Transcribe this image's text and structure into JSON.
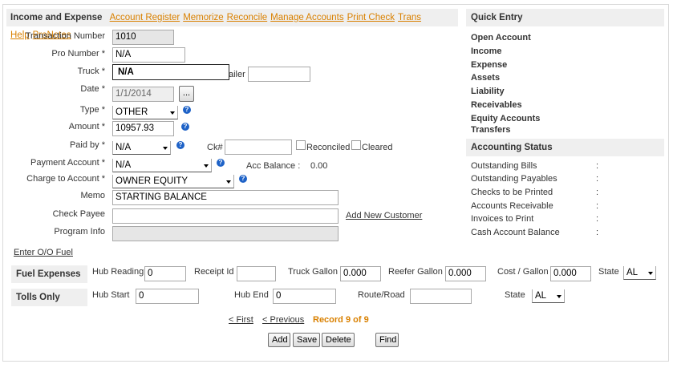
{
  "header": {
    "title": "Income and Expense",
    "links": [
      "Account Register",
      "Memorize",
      "Reconcile",
      "Manage Accounts",
      "Print Check",
      "Trans Help",
      "ProNotes"
    ]
  },
  "form": {
    "transaction_number": {
      "label": "Transaction Number",
      "value": "1010"
    },
    "pro_number": {
      "label": "Pro Number *",
      "value": "N/A"
    },
    "truck": {
      "label": "Truck *",
      "value": "N/A"
    },
    "trailer": {
      "label_partial": "ailer",
      "value": ""
    },
    "date": {
      "label": "Date *",
      "value": "1/1/2014",
      "picker_label": "..."
    },
    "type": {
      "label": "Type *",
      "value": "OTHER"
    },
    "amount": {
      "label": "Amount *",
      "value": "10957.93"
    },
    "paid_by": {
      "label": "Paid by *",
      "value": "N/A"
    },
    "check_number": {
      "label": "Ck#",
      "value": ""
    },
    "reconciled_label": "Reconciled",
    "cleared_label": "Cleared",
    "payment_account": {
      "label": "Payment Account *",
      "value": "N/A"
    },
    "acc_balance": {
      "label": "Acc Balance :",
      "value": "0.00"
    },
    "charge_to_account": {
      "label": "Charge to Account *",
      "value": "OWNER EQUITY"
    },
    "memo": {
      "label": "Memo",
      "value": "STARTING BALANCE"
    },
    "check_payee": {
      "label": "Check Payee",
      "value": ""
    },
    "add_customer_label": "Add New Customer",
    "program_info": {
      "label": "Program Info",
      "value": ""
    },
    "help_glyph": "?"
  },
  "enter_fuel_label": "Enter O/O Fuel",
  "fuel": {
    "title": "Fuel Expenses",
    "hub_reading": {
      "label": "Hub Reading",
      "value": "0"
    },
    "receipt_id": {
      "label": "Receipt Id",
      "value": ""
    },
    "truck_gallon": {
      "label": "Truck Gallon",
      "value": "0.000"
    },
    "reefer_gallon": {
      "label": "Reefer Gallon",
      "value": "0.000"
    },
    "cost_gallon": {
      "label": "Cost / Gallon",
      "value": "0.000"
    },
    "state": {
      "label": "State",
      "value": "AL"
    }
  },
  "tolls": {
    "title": "Tolls Only",
    "hub_start": {
      "label": "Hub Start",
      "value": "0"
    },
    "hub_end": {
      "label": "Hub End",
      "value": "0"
    },
    "route_road": {
      "label": "Route/Road",
      "value": ""
    },
    "state": {
      "label": "State",
      "value": "AL"
    }
  },
  "pager": {
    "first": "< First",
    "previous": "< Previous",
    "record": "Record 9 of 9"
  },
  "buttons": {
    "add": "Add",
    "save": "Save",
    "delete": "Delete",
    "find": "Find"
  },
  "quick_entry": {
    "title": "Quick Entry",
    "items": [
      "Open Account",
      "Income",
      "Expense",
      "Assets",
      "Liability",
      "Receivables",
      "Equity Accounts",
      "Transfers"
    ]
  },
  "accounting_status": {
    "title": "Accounting Status",
    "items": [
      {
        "label": "Outstanding Bills",
        "sep": ":"
      },
      {
        "label": "Outstanding Payables",
        "sep": ":"
      },
      {
        "label": "Checks to be Printed",
        "sep": ":"
      },
      {
        "label": "Accounts Receivable",
        "sep": ":"
      },
      {
        "label": "Invoices to Print",
        "sep": ":"
      },
      {
        "label": "Cash Account Balance",
        "sep": ":"
      }
    ]
  },
  "colors": {
    "link": "#d98000",
    "header_bg": "#efefef",
    "help_icon": "#1e62c7"
  }
}
